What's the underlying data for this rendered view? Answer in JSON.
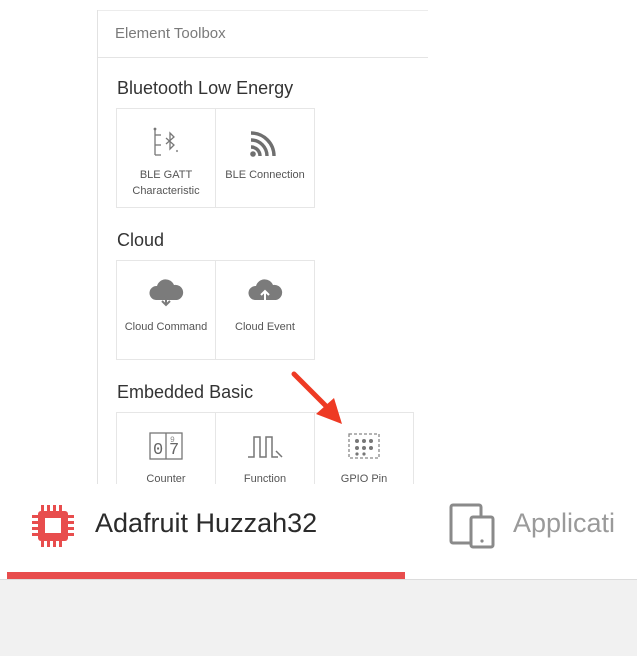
{
  "toolbox": {
    "title": "Element Toolbox",
    "sections": [
      {
        "title": "Bluetooth Low Energy",
        "items": [
          {
            "label": "BLE GATT Characteristic",
            "icon": "ble-gatt-icon"
          },
          {
            "label": "BLE Connection",
            "icon": "ble-connection-icon"
          }
        ]
      },
      {
        "title": "Cloud",
        "items": [
          {
            "label": "Cloud Command",
            "icon": "cloud-download-icon"
          },
          {
            "label": "Cloud Event",
            "icon": "cloud-upload-icon"
          }
        ]
      },
      {
        "title": "Embedded Basic",
        "items": [
          {
            "label": "Counter",
            "icon": "counter-icon"
          },
          {
            "label": "Function",
            "icon": "function-icon"
          },
          {
            "label": "GPIO Pin",
            "icon": "gpio-pin-icon"
          }
        ]
      }
    ]
  },
  "tabs": {
    "device": {
      "label": "Adafruit Huzzah32",
      "icon": "chip-icon"
    },
    "application": {
      "label": "Applicati",
      "icon": "devices-icon"
    }
  },
  "colors": {
    "accent": "#e84d4d",
    "annotation_arrow": "#ee3a24"
  }
}
